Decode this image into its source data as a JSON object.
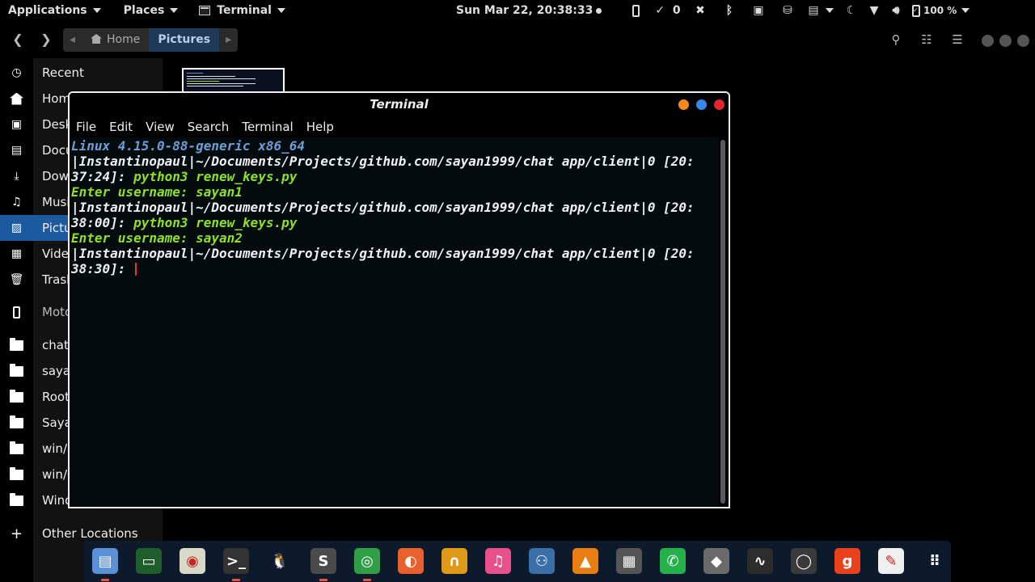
{
  "topbar": {
    "applications": "Applications",
    "places": "Places",
    "terminal": "Terminal",
    "clock": "Sun Mar 22, 20:38:33",
    "updates_count": "0",
    "battery": "100 %"
  },
  "fm_header": {
    "path": [
      "Home",
      "Pictures"
    ]
  },
  "sidebar": {
    "items": [
      {
        "label": "Recent",
        "icon": "clock-icon"
      },
      {
        "label": "Home",
        "icon": "home-icon"
      },
      {
        "label": "Desktop",
        "icon": "desktop-icon"
      },
      {
        "label": "Documents",
        "icon": "document-icon"
      },
      {
        "label": "Downloads",
        "icon": "download-icon"
      },
      {
        "label": "Music",
        "icon": "music-icon"
      },
      {
        "label": "Pictures",
        "icon": "picture-icon"
      },
      {
        "label": "Videos",
        "icon": "video-icon"
      },
      {
        "label": "Trash",
        "icon": "trash-icon"
      },
      {
        "label": "Moto C Plus",
        "icon": "phone-icon"
      },
      {
        "label": "chat app",
        "icon": "folder-icon"
      },
      {
        "label": "sayan.gitub.com",
        "icon": "folder-icon"
      },
      {
        "label": "Root",
        "icon": "folder-icon"
      },
      {
        "label": "Sayan",
        "icon": "folder-icon"
      },
      {
        "label": "win/D",
        "icon": "folder-icon"
      },
      {
        "label": "win/C",
        "icon": "folder-icon"
      },
      {
        "label": "Windows Network",
        "icon": "folder-icon"
      },
      {
        "label": "Other Locations",
        "icon": "plus-icon"
      }
    ]
  },
  "terminal": {
    "title": "Terminal",
    "menu": [
      "File",
      "Edit",
      "View",
      "Search",
      "Terminal",
      "Help"
    ],
    "lines": [
      {
        "text": "Linux 4.15.0-88-generic x86_64",
        "color": "#6d9ed8"
      },
      {
        "text": "|Instantinopaul|~/Documents/Projects/github.com/sayan1999/chat app/client|0 [20:",
        "color": "#f0f0f0"
      },
      {
        "text": "37:24]: ",
        "cmd": "python3 renew_keys.py",
        "color": "#f0f0f0"
      },
      {
        "text": "Enter username: sayan1",
        "color": "#8ee02a"
      },
      {
        "text": "|Instantinopaul|~/Documents/Projects/github.com/sayan1999/chat app/client|0 [20:",
        "color": "#f0f0f0"
      },
      {
        "text": "38:00]: ",
        "cmd": "python3 renew_keys.py",
        "color": "#f0f0f0"
      },
      {
        "text": "Enter username: sayan2",
        "color": "#8ee02a"
      },
      {
        "text": "|Instantinopaul|~/Documents/Projects/github.com/sayan1999/chat app/client|0 [20:",
        "color": "#f0f0f0"
      },
      {
        "text": "38:30]: ",
        "color": "#f0f0f0"
      }
    ]
  },
  "dock": {
    "apps": [
      {
        "name": "files-icon",
        "glyph": "▤",
        "bg": "#5b8fd6",
        "running": true
      },
      {
        "name": "system-monitor-icon",
        "glyph": "▭",
        "bg": "#1f5d2a",
        "running": false
      },
      {
        "name": "speaker-icon",
        "glyph": "◉",
        "bg": "#d9d9c8",
        "running": false
      },
      {
        "name": "terminal-icon",
        "glyph": ">_",
        "bg": "#333333",
        "running": true
      },
      {
        "name": "tux-icon",
        "glyph": "🐧",
        "bg": "#0c1a2c",
        "running": false
      },
      {
        "name": "sublime-icon",
        "glyph": "S",
        "bg": "#4a4a4a",
        "running": true
      },
      {
        "name": "chrome-icon",
        "glyph": "◎",
        "bg": "#2f9e44",
        "running": true
      },
      {
        "name": "firefox-icon",
        "glyph": "◐",
        "bg": "#e8612c",
        "running": false
      },
      {
        "name": "headphones-icon",
        "glyph": "∩",
        "bg": "#e09a1a",
        "running": false
      },
      {
        "name": "itunes-icon",
        "glyph": "♫",
        "bg": "#e8508c",
        "running": false
      },
      {
        "name": "python-icon",
        "glyph": "⚇",
        "bg": "#3b6fa8",
        "running": false
      },
      {
        "name": "vlc-icon",
        "glyph": "▲",
        "bg": "#e87d12",
        "running": false
      },
      {
        "name": "jupyter-icon",
        "glyph": "▦",
        "bg": "#555555",
        "running": false
      },
      {
        "name": "whatsapp-icon",
        "glyph": "✆",
        "bg": "#25b04a",
        "running": false
      },
      {
        "name": "inkscape-icon",
        "glyph": "◆",
        "bg": "#6a6a6a",
        "running": false
      },
      {
        "name": "activity-monitor-icon",
        "glyph": "∿",
        "bg": "#2d2d2d",
        "running": false
      },
      {
        "name": "screen-recorder-icon",
        "glyph": "◯",
        "bg": "#3a3a3a",
        "running": false
      },
      {
        "name": "g-app-icon",
        "glyph": "g",
        "bg": "#e8421c",
        "running": false
      },
      {
        "name": "editor-icon",
        "glyph": "✎",
        "bg": "#f0f0f0",
        "running": false
      },
      {
        "name": "apps-grid-icon",
        "glyph": "⠿",
        "bg": "#0c1a2c",
        "running": false
      }
    ]
  }
}
